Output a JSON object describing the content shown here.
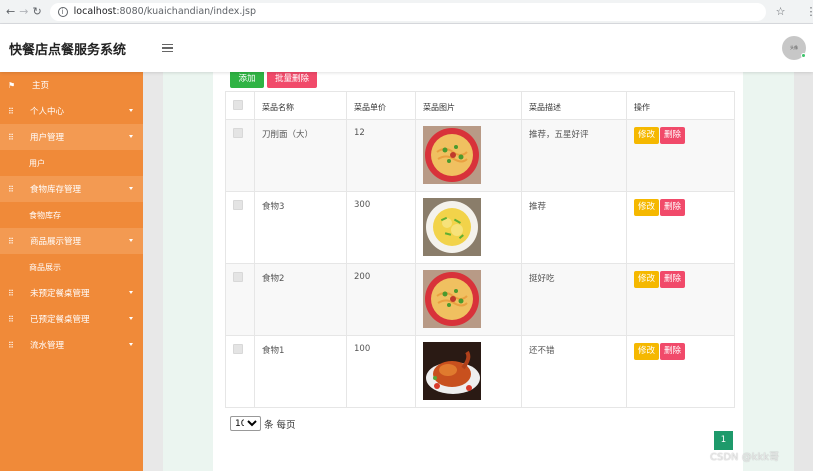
{
  "browser": {
    "url_host": "localhost",
    "url_rest": ":8080/kuaichandian/index.jsp"
  },
  "header": {
    "app_title": "快餐店点餐服务系统",
    "avatar_text": "头像"
  },
  "sidebar": {
    "items": [
      {
        "label": "主页"
      },
      {
        "label": "个人中心"
      },
      {
        "label": "用户管理"
      },
      {
        "label": "用户"
      },
      {
        "label": "食物库存管理"
      },
      {
        "label": "食物库存"
      },
      {
        "label": "商品展示管理"
      },
      {
        "label": "商品展示"
      },
      {
        "label": "未预定餐桌管理"
      },
      {
        "label": "已预定餐桌管理"
      },
      {
        "label": "流水管理"
      }
    ]
  },
  "toolbar": {
    "add_label": "添加",
    "batch_delete_label": "批量删除"
  },
  "table": {
    "headers": [
      "菜品名称",
      "菜品单价",
      "菜品图片",
      "菜品描述",
      "操作"
    ],
    "rows": [
      {
        "name": "刀削面（大）",
        "price": "12",
        "image": "noodle-bowl",
        "desc": "推荐，五星好评"
      },
      {
        "name": "食物3",
        "price": "300",
        "image": "egg-plate",
        "desc": "推荐"
      },
      {
        "name": "食物2",
        "price": "200",
        "image": "noodle-bowl",
        "desc": "挺好吃"
      },
      {
        "name": "食物1",
        "price": "100",
        "image": "roast-duck",
        "desc": "还不错"
      }
    ],
    "edit_label": "修改",
    "delete_label": "删除"
  },
  "pagination": {
    "page_size": "10",
    "per_page_label": "条 每页",
    "current_page": "1"
  },
  "watermark": "CSDN @kkk哥",
  "colors": {
    "sidebar": "#f08a39",
    "add": "#2fb344",
    "delete": "#f14a6a",
    "edit": "#f5b800",
    "page": "#1e9a6b"
  }
}
